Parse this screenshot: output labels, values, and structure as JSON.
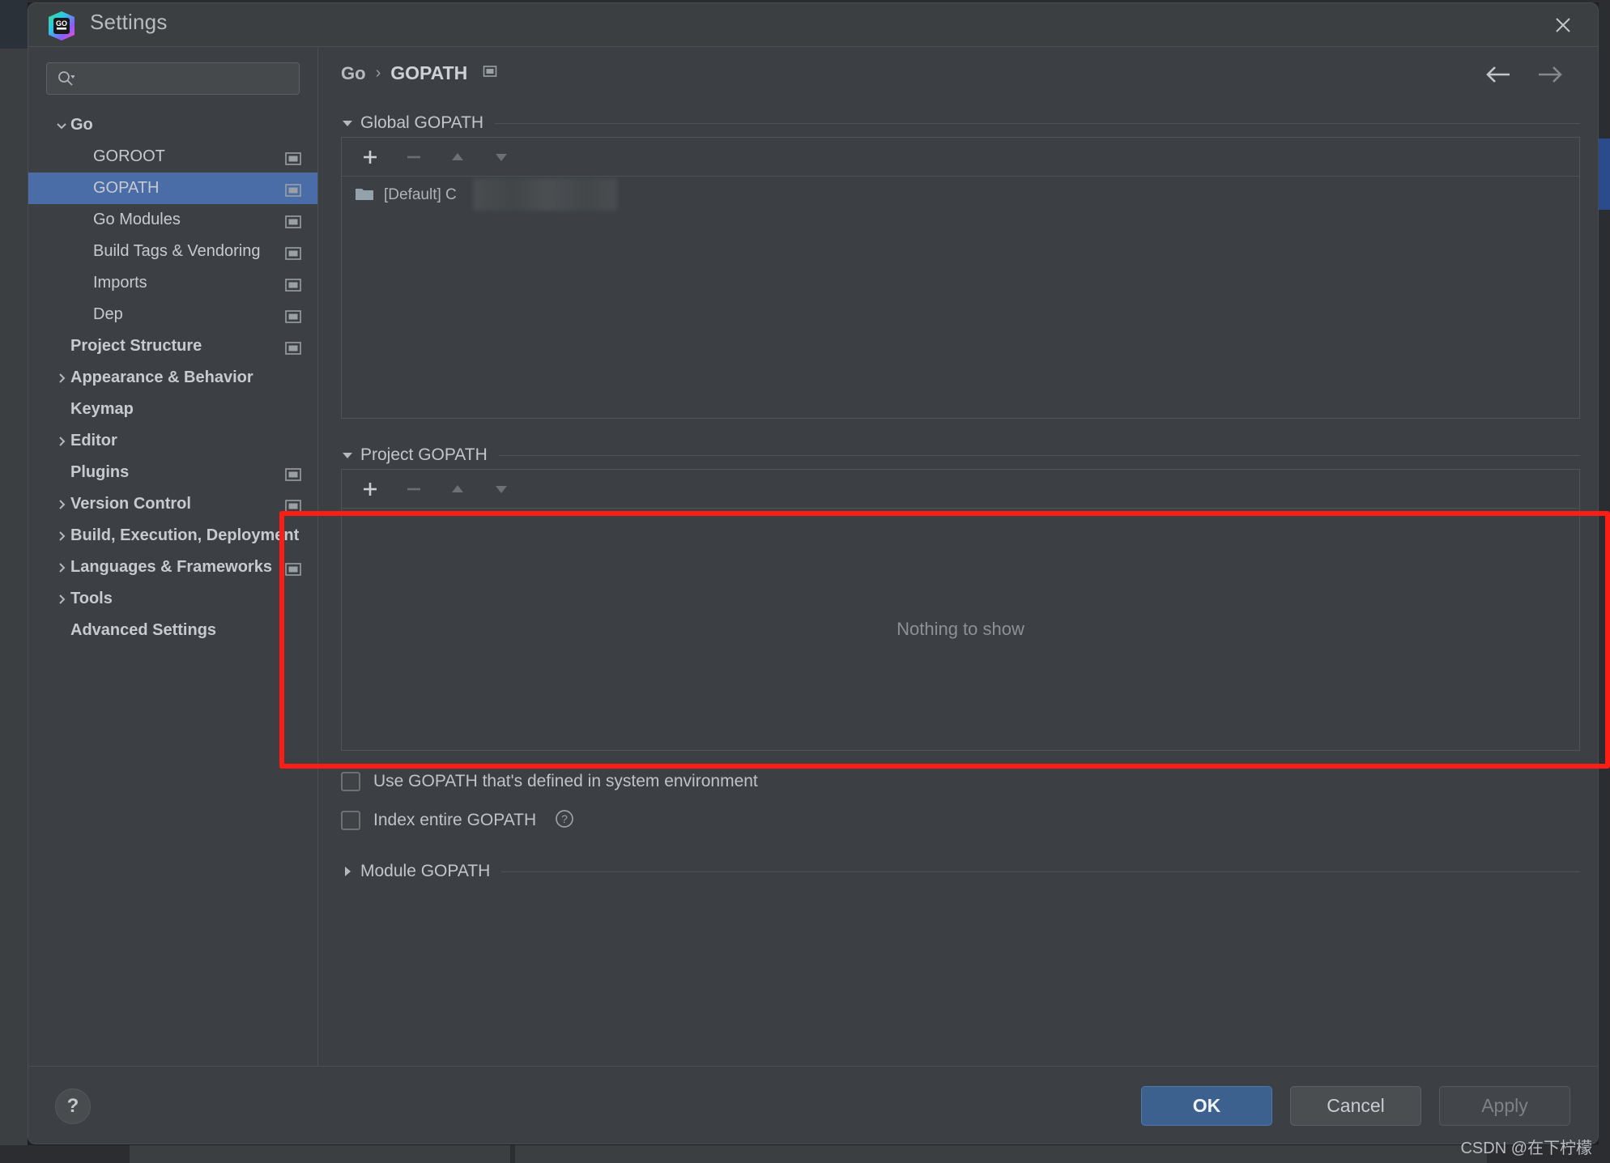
{
  "window": {
    "title": "Settings",
    "app_icon": "go-logo-icon",
    "close_label": "✕"
  },
  "search": {
    "placeholder": "",
    "value": "",
    "icon": "search-icon"
  },
  "sidebar": {
    "items": [
      {
        "label": "Go",
        "level": 0,
        "arrow": "down",
        "bold": true,
        "badge": false,
        "selected": false
      },
      {
        "label": "GOROOT",
        "level": 1,
        "arrow": "none",
        "bold": false,
        "badge": true,
        "selected": false
      },
      {
        "label": "GOPATH",
        "level": 1,
        "arrow": "none",
        "bold": false,
        "badge": true,
        "selected": true
      },
      {
        "label": "Go Modules",
        "level": 1,
        "arrow": "none",
        "bold": false,
        "badge": true,
        "selected": false
      },
      {
        "label": "Build Tags & Vendoring",
        "level": 1,
        "arrow": "none",
        "bold": false,
        "badge": true,
        "selected": false
      },
      {
        "label": "Imports",
        "level": 1,
        "arrow": "none",
        "bold": false,
        "badge": true,
        "selected": false
      },
      {
        "label": "Dep",
        "level": 1,
        "arrow": "none",
        "bold": false,
        "badge": true,
        "selected": false
      },
      {
        "label": "Project Structure",
        "level": 0,
        "arrow": "none",
        "bold": true,
        "badge": true,
        "selected": false
      },
      {
        "label": "Appearance & Behavior",
        "level": 0,
        "arrow": "right",
        "bold": true,
        "badge": false,
        "selected": false
      },
      {
        "label": "Keymap",
        "level": 0,
        "arrow": "none",
        "bold": true,
        "badge": false,
        "selected": false
      },
      {
        "label": "Editor",
        "level": 0,
        "arrow": "right",
        "bold": true,
        "badge": false,
        "selected": false
      },
      {
        "label": "Plugins",
        "level": 0,
        "arrow": "none",
        "bold": true,
        "badge": true,
        "selected": false
      },
      {
        "label": "Version Control",
        "level": 0,
        "arrow": "right",
        "bold": true,
        "badge": true,
        "selected": false
      },
      {
        "label": "Build, Execution, Deployment",
        "level": 0,
        "arrow": "right",
        "bold": true,
        "badge": false,
        "selected": false
      },
      {
        "label": "Languages & Frameworks",
        "level": 0,
        "arrow": "right",
        "bold": true,
        "badge": true,
        "selected": false
      },
      {
        "label": "Tools",
        "level": 0,
        "arrow": "right",
        "bold": true,
        "badge": false,
        "selected": false
      },
      {
        "label": "Advanced Settings",
        "level": 0,
        "arrow": "none",
        "bold": true,
        "badge": false,
        "selected": false
      }
    ]
  },
  "breadcrumb": {
    "root": "Go",
    "separator": "›",
    "current": "GOPATH",
    "badge": "project-scope-icon"
  },
  "nav": {
    "back_icon": "arrow-left-icon",
    "forward_icon": "arrow-right-icon"
  },
  "global_gopath": {
    "title": "Global GOPATH",
    "expanded": true,
    "toolbar": {
      "add": "+",
      "remove": "−",
      "up": "▲",
      "down": "▼"
    },
    "rows": [
      {
        "icon": "folder-icon",
        "text": "[Default] C",
        "redacted": true
      }
    ]
  },
  "project_gopath": {
    "title": "Project GOPATH",
    "expanded": true,
    "toolbar": {
      "add": "+",
      "remove": "−",
      "up": "▲",
      "down": "▼"
    },
    "empty_text": "Nothing to show"
  },
  "options": [
    {
      "label": "Use GOPATH that's defined in system environment",
      "checked": false,
      "help": false
    },
    {
      "label": "Index entire GOPATH",
      "checked": false,
      "help": true,
      "help_icon": "question-circle-icon"
    }
  ],
  "module_gopath": {
    "title": "Module GOPATH",
    "expanded": false
  },
  "footer": {
    "help_icon": "question-mark-button",
    "ok_label": "OK",
    "cancel_label": "Cancel",
    "apply_label": "Apply",
    "apply_disabled": true
  },
  "annotation": {
    "type": "red-rectangle-highlight",
    "color": "#fe1d15",
    "target": "Project GOPATH"
  },
  "watermark": {
    "text": "CSDN @在下柠檬"
  },
  "colors": {
    "dialog_bg": "#3c4044",
    "selection_blue": "#4a6da7",
    "primary_button": "#3c618f",
    "annotation_red": "#fe1d15",
    "text_primary": "#c7cace",
    "text_muted": "#8e9194"
  }
}
